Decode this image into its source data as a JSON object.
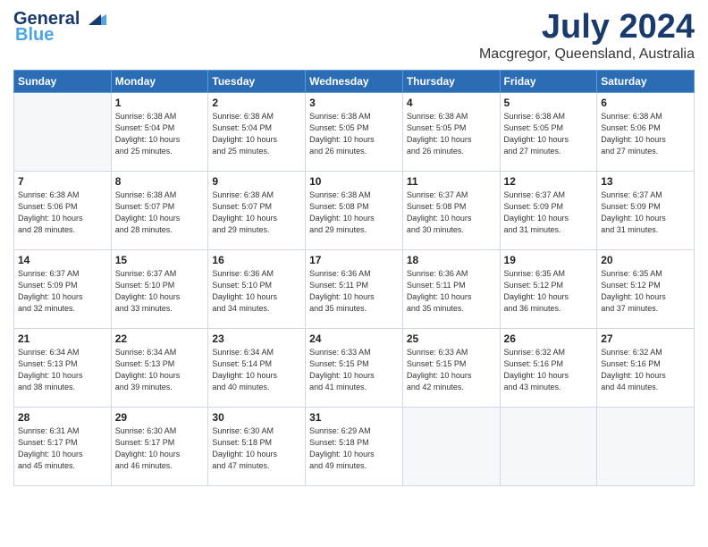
{
  "header": {
    "logo_line1": "General",
    "logo_line2": "Blue",
    "month": "July 2024",
    "location": "Macgregor, Queensland, Australia"
  },
  "weekdays": [
    "Sunday",
    "Monday",
    "Tuesday",
    "Wednesday",
    "Thursday",
    "Friday",
    "Saturday"
  ],
  "weeks": [
    [
      {
        "day": "",
        "sunrise": "",
        "sunset": "",
        "daylight": ""
      },
      {
        "day": "1",
        "sunrise": "Sunrise: 6:38 AM",
        "sunset": "Sunset: 5:04 PM",
        "daylight": "Daylight: 10 hours and 25 minutes."
      },
      {
        "day": "2",
        "sunrise": "Sunrise: 6:38 AM",
        "sunset": "Sunset: 5:04 PM",
        "daylight": "Daylight: 10 hours and 25 minutes."
      },
      {
        "day": "3",
        "sunrise": "Sunrise: 6:38 AM",
        "sunset": "Sunset: 5:05 PM",
        "daylight": "Daylight: 10 hours and 26 minutes."
      },
      {
        "day": "4",
        "sunrise": "Sunrise: 6:38 AM",
        "sunset": "Sunset: 5:05 PM",
        "daylight": "Daylight: 10 hours and 26 minutes."
      },
      {
        "day": "5",
        "sunrise": "Sunrise: 6:38 AM",
        "sunset": "Sunset: 5:05 PM",
        "daylight": "Daylight: 10 hours and 27 minutes."
      },
      {
        "day": "6",
        "sunrise": "Sunrise: 6:38 AM",
        "sunset": "Sunset: 5:06 PM",
        "daylight": "Daylight: 10 hours and 27 minutes."
      }
    ],
    [
      {
        "day": "7",
        "sunrise": "Sunrise: 6:38 AM",
        "sunset": "Sunset: 5:06 PM",
        "daylight": "Daylight: 10 hours and 28 minutes."
      },
      {
        "day": "8",
        "sunrise": "Sunrise: 6:38 AM",
        "sunset": "Sunset: 5:07 PM",
        "daylight": "Daylight: 10 hours and 28 minutes."
      },
      {
        "day": "9",
        "sunrise": "Sunrise: 6:38 AM",
        "sunset": "Sunset: 5:07 PM",
        "daylight": "Daylight: 10 hours and 29 minutes."
      },
      {
        "day": "10",
        "sunrise": "Sunrise: 6:38 AM",
        "sunset": "Sunset: 5:08 PM",
        "daylight": "Daylight: 10 hours and 29 minutes."
      },
      {
        "day": "11",
        "sunrise": "Sunrise: 6:37 AM",
        "sunset": "Sunset: 5:08 PM",
        "daylight": "Daylight: 10 hours and 30 minutes."
      },
      {
        "day": "12",
        "sunrise": "Sunrise: 6:37 AM",
        "sunset": "Sunset: 5:09 PM",
        "daylight": "Daylight: 10 hours and 31 minutes."
      },
      {
        "day": "13",
        "sunrise": "Sunrise: 6:37 AM",
        "sunset": "Sunset: 5:09 PM",
        "daylight": "Daylight: 10 hours and 31 minutes."
      }
    ],
    [
      {
        "day": "14",
        "sunrise": "Sunrise: 6:37 AM",
        "sunset": "Sunset: 5:09 PM",
        "daylight": "Daylight: 10 hours and 32 minutes."
      },
      {
        "day": "15",
        "sunrise": "Sunrise: 6:37 AM",
        "sunset": "Sunset: 5:10 PM",
        "daylight": "Daylight: 10 hours and 33 minutes."
      },
      {
        "day": "16",
        "sunrise": "Sunrise: 6:36 AM",
        "sunset": "Sunset: 5:10 PM",
        "daylight": "Daylight: 10 hours and 34 minutes."
      },
      {
        "day": "17",
        "sunrise": "Sunrise: 6:36 AM",
        "sunset": "Sunset: 5:11 PM",
        "daylight": "Daylight: 10 hours and 35 minutes."
      },
      {
        "day": "18",
        "sunrise": "Sunrise: 6:36 AM",
        "sunset": "Sunset: 5:11 PM",
        "daylight": "Daylight: 10 hours and 35 minutes."
      },
      {
        "day": "19",
        "sunrise": "Sunrise: 6:35 AM",
        "sunset": "Sunset: 5:12 PM",
        "daylight": "Daylight: 10 hours and 36 minutes."
      },
      {
        "day": "20",
        "sunrise": "Sunrise: 6:35 AM",
        "sunset": "Sunset: 5:12 PM",
        "daylight": "Daylight: 10 hours and 37 minutes."
      }
    ],
    [
      {
        "day": "21",
        "sunrise": "Sunrise: 6:34 AM",
        "sunset": "Sunset: 5:13 PM",
        "daylight": "Daylight: 10 hours and 38 minutes."
      },
      {
        "day": "22",
        "sunrise": "Sunrise: 6:34 AM",
        "sunset": "Sunset: 5:13 PM",
        "daylight": "Daylight: 10 hours and 39 minutes."
      },
      {
        "day": "23",
        "sunrise": "Sunrise: 6:34 AM",
        "sunset": "Sunset: 5:14 PM",
        "daylight": "Daylight: 10 hours and 40 minutes."
      },
      {
        "day": "24",
        "sunrise": "Sunrise: 6:33 AM",
        "sunset": "Sunset: 5:15 PM",
        "daylight": "Daylight: 10 hours and 41 minutes."
      },
      {
        "day": "25",
        "sunrise": "Sunrise: 6:33 AM",
        "sunset": "Sunset: 5:15 PM",
        "daylight": "Daylight: 10 hours and 42 minutes."
      },
      {
        "day": "26",
        "sunrise": "Sunrise: 6:32 AM",
        "sunset": "Sunset: 5:16 PM",
        "daylight": "Daylight: 10 hours and 43 minutes."
      },
      {
        "day": "27",
        "sunrise": "Sunrise: 6:32 AM",
        "sunset": "Sunset: 5:16 PM",
        "daylight": "Daylight: 10 hours and 44 minutes."
      }
    ],
    [
      {
        "day": "28",
        "sunrise": "Sunrise: 6:31 AM",
        "sunset": "Sunset: 5:17 PM",
        "daylight": "Daylight: 10 hours and 45 minutes."
      },
      {
        "day": "29",
        "sunrise": "Sunrise: 6:30 AM",
        "sunset": "Sunset: 5:17 PM",
        "daylight": "Daylight: 10 hours and 46 minutes."
      },
      {
        "day": "30",
        "sunrise": "Sunrise: 6:30 AM",
        "sunset": "Sunset: 5:18 PM",
        "daylight": "Daylight: 10 hours and 47 minutes."
      },
      {
        "day": "31",
        "sunrise": "Sunrise: 6:29 AM",
        "sunset": "Sunset: 5:18 PM",
        "daylight": "Daylight: 10 hours and 49 minutes."
      },
      {
        "day": "",
        "sunrise": "",
        "sunset": "",
        "daylight": ""
      },
      {
        "day": "",
        "sunrise": "",
        "sunset": "",
        "daylight": ""
      },
      {
        "day": "",
        "sunrise": "",
        "sunset": "",
        "daylight": ""
      }
    ]
  ]
}
